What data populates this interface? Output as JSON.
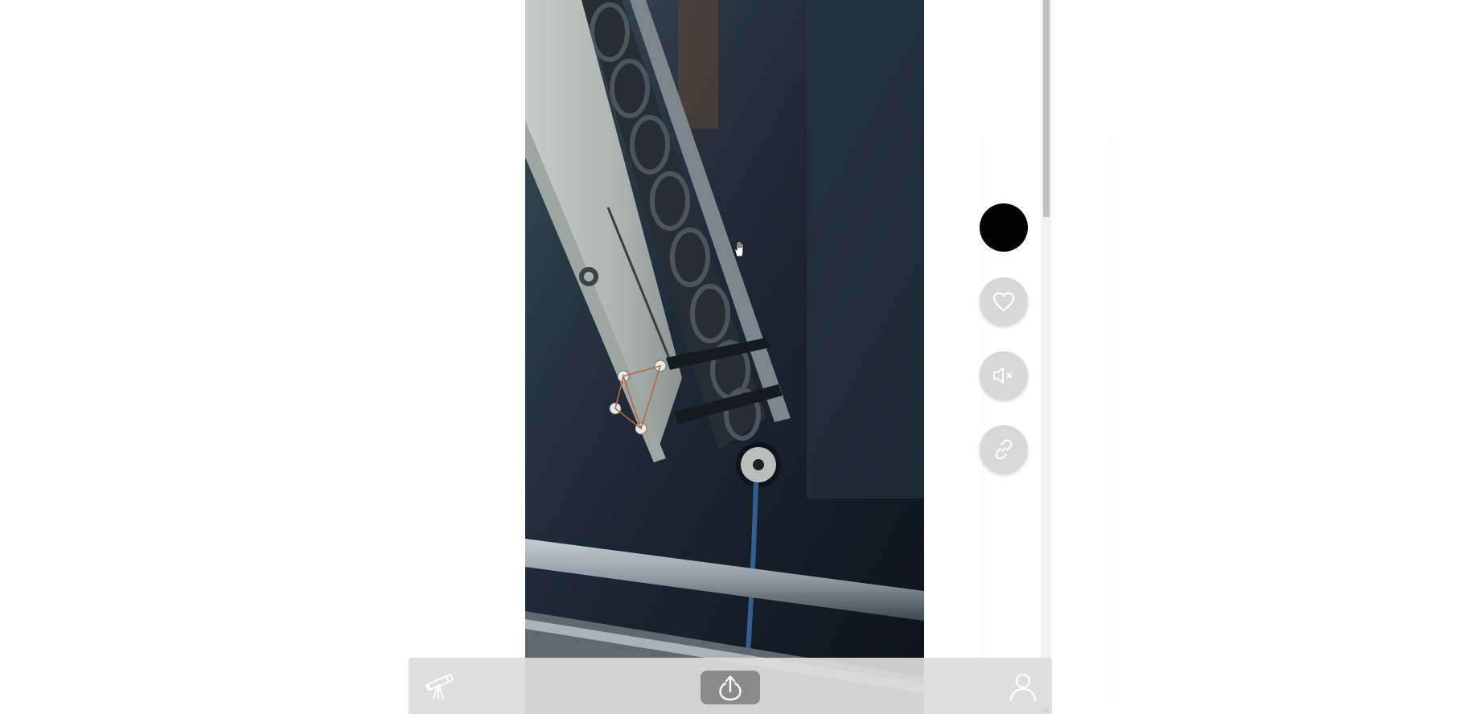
{
  "video": {
    "description_icon": "video-frame"
  },
  "actions": {
    "items": [
      {
        "name": "creator-avatar",
        "icon": "avatar-circle"
      },
      {
        "name": "like",
        "icon": "heart-icon"
      },
      {
        "name": "mute",
        "icon": "muted-speaker-icon"
      },
      {
        "name": "copy-link",
        "icon": "link-icon"
      }
    ]
  },
  "bottom_nav": {
    "items": [
      {
        "name": "discover",
        "icon": "telescope-icon"
      },
      {
        "name": "upload",
        "icon": "upload-icon"
      },
      {
        "name": "profile",
        "icon": "user-icon"
      }
    ]
  },
  "colors": {
    "avatar": "#000000",
    "action_button_bg": "#d8d8d8",
    "nav_bg": "#dcdcda"
  }
}
